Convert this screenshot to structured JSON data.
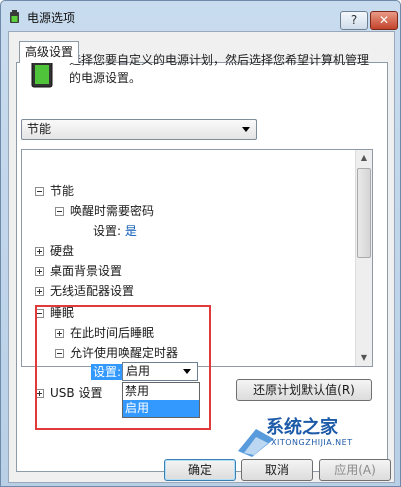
{
  "window": {
    "title": "电源选项",
    "help_label": "?",
    "close_label": "✕"
  },
  "tab": {
    "label": "高级设置"
  },
  "description": "选择您要自定义的电源计划，然后选择您希望计算机管理的电源设置。",
  "plan_select": {
    "value": "节能"
  },
  "tree": {
    "items": [
      {
        "label": "节能",
        "expander": "minus"
      },
      {
        "label": "唤醒时需要密码",
        "expander": "minus"
      },
      {
        "label": "设置:",
        "value": "是"
      },
      {
        "label": "硬盘",
        "expander": "plus"
      },
      {
        "label": "桌面背景设置",
        "expander": "plus"
      },
      {
        "label": "无线适配器设置",
        "expander": "plus"
      },
      {
        "label": "睡眠",
        "expander": "minus"
      },
      {
        "label": "在此时间后睡眠",
        "expander": "plus"
      },
      {
        "label": "允许使用唤醒定时器",
        "expander": "minus"
      },
      {
        "label": "设置:"
      },
      {
        "label": "USB 设置",
        "expander": "plus"
      }
    ],
    "inline_select_value": "启用",
    "dropdown_options": [
      "禁用",
      "启用"
    ],
    "dropdown_selected": "启用"
  },
  "restore_button": "还原计划默认值(R)",
  "footer": {
    "ok": "确定",
    "cancel": "取消",
    "apply": "应用(A)"
  },
  "watermark": {
    "text": "系统之家",
    "sub": "XITONGZHIJIA.NET"
  },
  "colors": {
    "highlight": "#3399ff",
    "annotation_red": "#e23a3a",
    "link_blue": "#0a58b5"
  }
}
